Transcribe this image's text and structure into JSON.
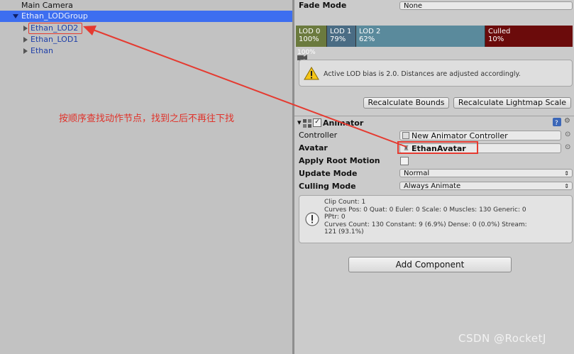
{
  "hierarchy": {
    "items": [
      {
        "label": "Main Camera"
      },
      {
        "label": "Ethan_LODGroup"
      },
      {
        "label": "Ethan_LOD2"
      },
      {
        "label": "Ethan_LOD1"
      },
      {
        "label": "Ethan"
      }
    ]
  },
  "annotation": {
    "text": "按顺序查找动作节点，找到之后不再往下找",
    "color": "#e0322a"
  },
  "inspector": {
    "fade_mode": {
      "label": "Fade Mode",
      "value": "None"
    },
    "lod": {
      "segments": [
        {
          "name": "LOD 0",
          "percent": "100%",
          "color": "#6b7a3e"
        },
        {
          "name": "LOD 1",
          "percent": "79%",
          "color": "#4a6c84"
        },
        {
          "name": "LOD 2",
          "percent": "62%",
          "color": "#5a8a9c"
        },
        {
          "name": "Culled",
          "percent": "10%",
          "color": "#6b0b0b"
        }
      ],
      "marker": "100%"
    },
    "warning": "Active LOD bias is 2.0. Distances are adjusted accordingly.",
    "recalc_bounds": "Recalculate Bounds",
    "recalc_lightmap": "Recalculate Lightmap Scale",
    "animator": {
      "title": "Animator",
      "controller_label": "Controller",
      "controller_value": "New Animator Controller",
      "avatar_label": "Avatar",
      "avatar_value": "EthanAvatar",
      "apply_root_label": "Apply Root Motion",
      "update_mode_label": "Update Mode",
      "update_mode_value": "Normal",
      "culling_mode_label": "Culling Mode",
      "culling_mode_value": "Always Animate",
      "info_lines": [
        "Clip Count: 1",
        "Curves Pos: 0 Quat: 0 Euler: 0 Scale: 0 Muscles: 130 Generic: 0",
        "PPtr: 0",
        "Curves Count: 130 Constant: 9 (6.9%) Dense: 0 (0.0%) Stream:",
        "121 (93.1%)"
      ]
    },
    "add_component": "Add Component"
  },
  "watermark": "CSDN @RocketJ"
}
